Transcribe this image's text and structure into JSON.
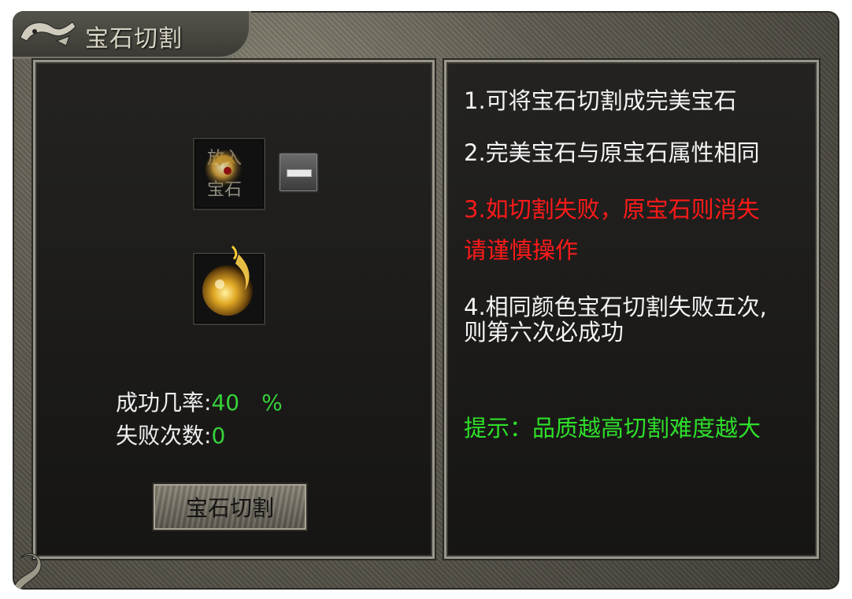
{
  "window": {
    "title": "宝石切割"
  },
  "left_panel": {
    "input_slot": {
      "label_top": "放入",
      "label_bottom": "宝石"
    },
    "success_rate_label": "成功几率:",
    "success_rate_value": "40",
    "success_rate_unit": "%",
    "fail_count_label": "失败次数:",
    "fail_count_value": "0",
    "cut_button_label": "宝石切割"
  },
  "right_panel": {
    "line1": "1.可将宝石切割成完美宝石",
    "line2": "2.完美宝石与原宝石属性相同",
    "line3": "3.如切割失败，原宝石则消失",
    "line3b": "请谨慎操作",
    "line4": "4.相同颜色宝石切割失败五次,",
    "line4b": "则第六次必成功",
    "hint": "提示：品质越高切割难度越大"
  },
  "colors": {
    "accent_green": "#2ee02a",
    "warning_red": "#ff1a1a",
    "text_white": "#f4f4f4"
  }
}
